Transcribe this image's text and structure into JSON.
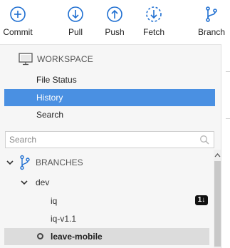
{
  "toolbar": {
    "commit": {
      "label": "Commit",
      "icon": "plus-circle-icon"
    },
    "pull": {
      "label": "Pull",
      "icon": "arrow-down-circle-icon"
    },
    "push": {
      "label": "Push",
      "icon": "arrow-up-circle-icon"
    },
    "fetch": {
      "label": "Fetch",
      "icon": "dashed-arrow-down-circle-icon"
    },
    "branch": {
      "label": "Branch",
      "icon": "branch-icon"
    }
  },
  "workspace": {
    "title": "WORKSPACE",
    "icon": "monitor-icon",
    "items": [
      {
        "label": "File Status",
        "selected": false
      },
      {
        "label": "History",
        "selected": true
      },
      {
        "label": "Search",
        "selected": false
      }
    ]
  },
  "search": {
    "placeholder": "Search",
    "value": ""
  },
  "branches": {
    "title": "BRANCHES",
    "group": "dev",
    "items": [
      {
        "label": "iq",
        "badge": "1↓"
      },
      {
        "label": "iq-v1.1"
      }
    ],
    "current": "leave-mobile"
  },
  "colors": {
    "accent": "#4a90e2",
    "toolbar_icon": "#1f6fd1",
    "selected_row": "#dcdcdc",
    "panel_bg": "#f6f6f6"
  }
}
